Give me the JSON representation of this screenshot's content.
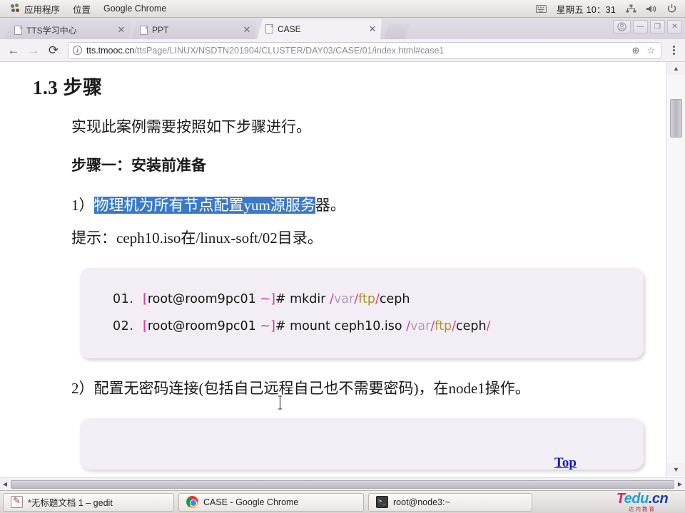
{
  "desktop": {
    "panel": {
      "menus": [
        {
          "label": "应用程序",
          "icon": "gnome-foot-icon"
        },
        {
          "label": "位置",
          "icon": ""
        },
        {
          "label": "Google Chrome",
          "icon": ""
        }
      ],
      "tray": {
        "input_method_icon": "keyboard-icon",
        "clock": "星期五 10：31",
        "network_icon": "network-icon",
        "volume_icon": "volume-icon",
        "power_icon": "power-icon"
      }
    },
    "taskbar": {
      "buttons": [
        {
          "label": "*无标题文档 1 – gedit",
          "icon": "gedit-icon"
        },
        {
          "label": "CASE - Google Chrome",
          "icon": "chrome-icon"
        },
        {
          "label": "root@node3:~",
          "icon": "terminal-icon"
        }
      ],
      "logo": {
        "t": "T",
        "edu": "edu",
        "cn": ".cn",
        "subtitle": "达内教育"
      }
    }
  },
  "browser": {
    "tabs": [
      {
        "title": "TTS学习中心",
        "active": false,
        "close": "✕"
      },
      {
        "title": "PPT",
        "active": false,
        "close": "✕"
      },
      {
        "title": "CASE",
        "active": true,
        "close": "✕"
      }
    ],
    "new_tab_label": "",
    "window_controls": {
      "avatar": "◉",
      "minimize": "—",
      "maximize": "❐",
      "close": "✕"
    },
    "toolbar": {
      "back": "←",
      "forward": "→",
      "reload": "⟳",
      "info_icon": "ⓘ",
      "url_host": "tts.tmooc.cn",
      "url_path": "/ttsPage/LINUX/NSDTN201904/CLUSTER/DAY03/CASE/01/index.html#case1",
      "zoom_icon": "⊕",
      "bookmark_icon": "☆",
      "menu_icon": "⋮"
    }
  },
  "page": {
    "section_title": "1.3 步骤",
    "intro": "实现此案例需要按照如下步骤进行。",
    "step_heading": "步骤一：安装前准备",
    "item1": {
      "number": "1）",
      "highlighted": "物理机为所有节点配置yum源服务",
      "tail": "器。"
    },
    "hint": "提示：ceph10.iso在/linux-soft/02目录。",
    "code_block_1": {
      "lines": [
        {
          "num": "01.",
          "segments": [
            {
              "text": "[",
              "style": "bracket"
            },
            {
              "text": "root@room9pc01 ",
              "style": "plain"
            },
            {
              "text": "~",
              "style": "tilde"
            },
            {
              "text": "]",
              "style": "bracket"
            },
            {
              "text": "# mkdir  ",
              "style": "plain"
            },
            {
              "text": "/",
              "style": "slash"
            },
            {
              "text": "var",
              "style": "var"
            },
            {
              "text": "/",
              "style": "slash"
            },
            {
              "text": "ftp",
              "style": "ftp"
            },
            {
              "text": "/",
              "style": "slash"
            },
            {
              "text": "ceph",
              "style": "plain"
            }
          ]
        },
        {
          "num": "02.",
          "segments": [
            {
              "text": "[",
              "style": "bracket"
            },
            {
              "text": "root@room9pc01 ",
              "style": "plain"
            },
            {
              "text": "~",
              "style": "tilde"
            },
            {
              "text": "]",
              "style": "bracket"
            },
            {
              "text": "# mount ceph10.iso ",
              "style": "plain"
            },
            {
              "text": "/",
              "style": "slash"
            },
            {
              "text": "var",
              "style": "var"
            },
            {
              "text": "/",
              "style": "slash"
            },
            {
              "text": "ftp",
              "style": "ftp"
            },
            {
              "text": "/",
              "style": "slash"
            },
            {
              "text": "ceph",
              "style": "plain"
            },
            {
              "text": "/",
              "style": "slash"
            }
          ]
        }
      ]
    },
    "item2": "2）配置无密码连接(包括自己远程自己也不需要密码)，在node1操作。",
    "top_link": "Top"
  },
  "colors": {
    "selection": "#3a79c8",
    "link": "#1019c8",
    "code_bg": "#f3eef5",
    "slash": "#e0359a",
    "ftp": "#a89427",
    "var": "#b29ab6"
  }
}
